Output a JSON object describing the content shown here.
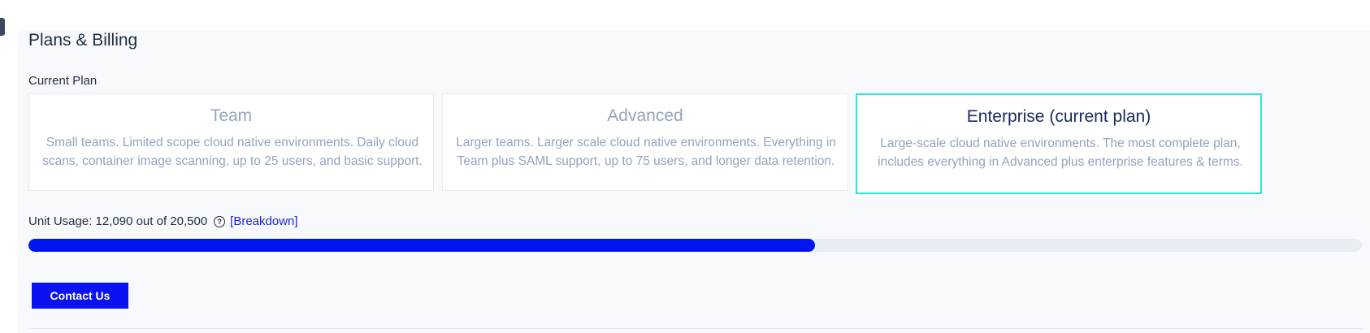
{
  "page": {
    "title": "Plans & Billing"
  },
  "current_plan": {
    "label": "Current Plan",
    "plans": [
      {
        "name": "Team",
        "description": "Small teams. Limited scope cloud native environments. Daily cloud scans, container image scanning, up to 25 users, and basic support.",
        "selected": false
      },
      {
        "name": "Advanced",
        "description": "Larger teams. Larger scale cloud native environments. Everything in Team plus SAML support, up to 75 users, and longer data retention.",
        "selected": false
      },
      {
        "name": "Enterprise (current plan)",
        "description": "Large-scale cloud native environments. The most complete plan, includes everything in Advanced plus enterprise features & terms.",
        "selected": true
      }
    ]
  },
  "usage": {
    "label": "Unit Usage: 12,090 out of 20,500",
    "help_icon": "question-circle-icon",
    "breakdown_link": "[Breakdown]",
    "used": 12090,
    "total": 20500
  },
  "actions": {
    "contact_label": "Contact Us"
  },
  "colors": {
    "accent": "#0a12f2",
    "current_plan_border": "#2ee6d6",
    "progress_track": "#e8edf3"
  }
}
